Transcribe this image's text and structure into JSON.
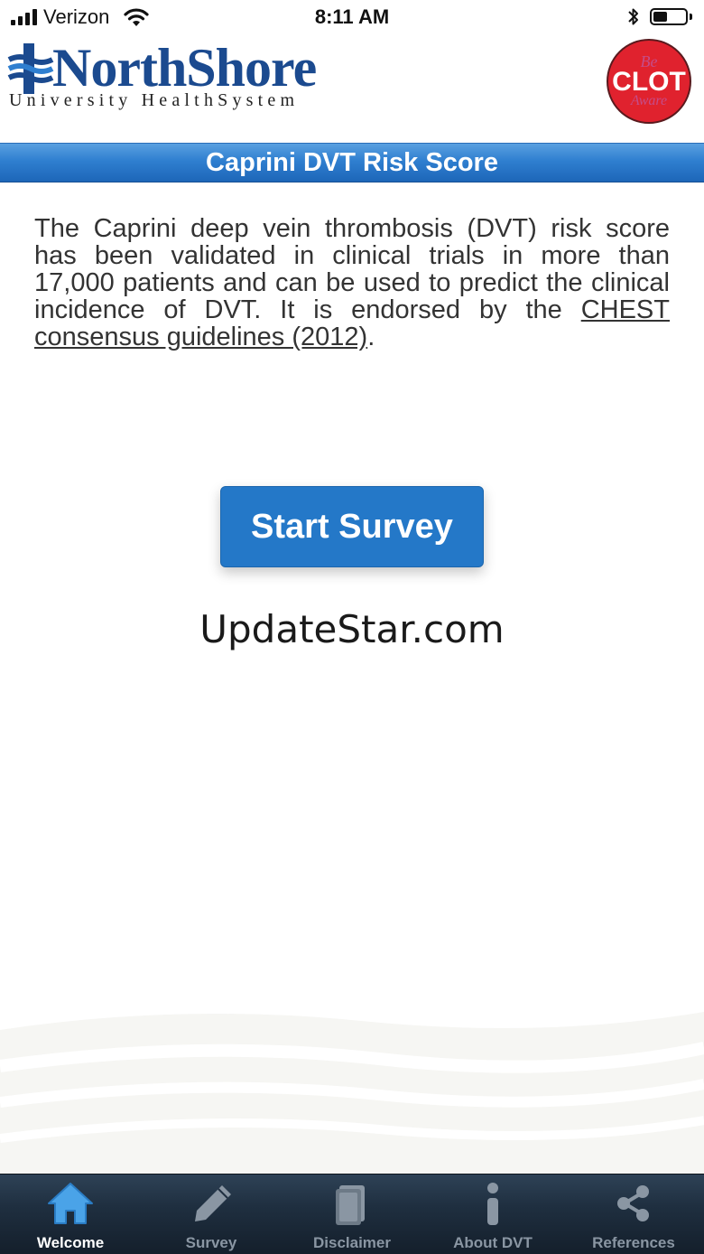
{
  "status_bar": {
    "carrier": "Verizon",
    "time": "8:11 AM",
    "battery_level": 0.45
  },
  "header": {
    "brand_name": "NorthShore",
    "brand_subtitle": "University HealthSystem",
    "badge": {
      "line1": "Be",
      "line2": "CLOT",
      "line3": "Aware"
    }
  },
  "title_bar": {
    "title": "Caprini DVT Risk Score"
  },
  "intro": {
    "text": "The Caprini deep vein thrombosis (DVT) risk score has been validated in clinical trials in more than 17,000 patients and can be used to predict the clinical incidence of DVT. It is endorsed by the ",
    "link_text": "CHEST consensus guidelines (2012)",
    "trailing": "."
  },
  "actions": {
    "start_label": "Start Survey"
  },
  "watermark": "UpdateStar.com",
  "tabs": [
    {
      "label": "Welcome",
      "icon": "home-icon",
      "active": true
    },
    {
      "label": "Survey",
      "icon": "pencil-icon",
      "active": false
    },
    {
      "label": "Disclaimer",
      "icon": "book-icon",
      "active": false
    },
    {
      "label": "About DVT",
      "icon": "info-icon",
      "active": false
    },
    {
      "label": "References",
      "icon": "share-icon",
      "active": false
    }
  ],
  "colors": {
    "brand_blue": "#1b4a8f",
    "title_bar_blue": "#2f7fd0",
    "button_blue": "#2478c8",
    "badge_red": "#e0222e",
    "tab_active_blue": "#4aa3e8",
    "tab_inactive": "#8a96a3"
  }
}
